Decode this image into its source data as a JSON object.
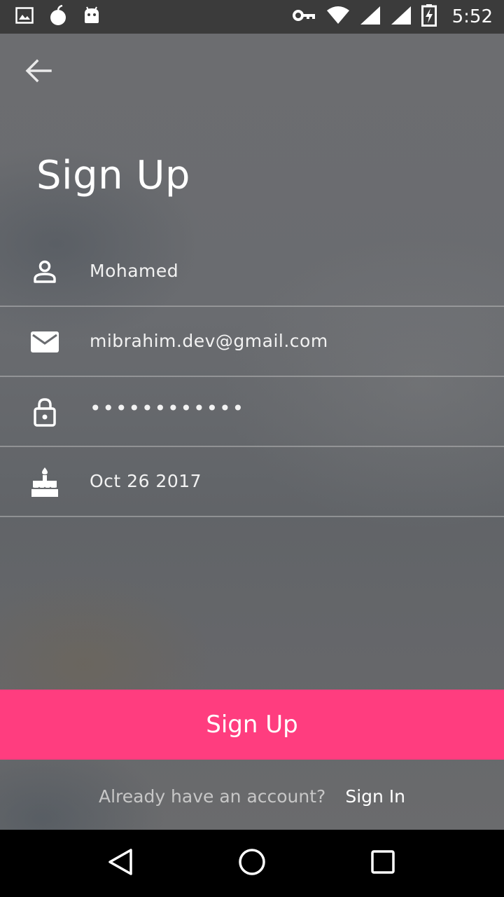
{
  "status_bar": {
    "time": "5:52",
    "icons_left": [
      "image-icon",
      "apple-notification-icon",
      "android-icon"
    ],
    "icons_right": [
      "vpn-key-icon",
      "wifi-icon",
      "signal-icon",
      "signal-icon",
      "battery-charging-icon"
    ]
  },
  "header": {
    "back_icon": "arrow-back-icon",
    "title": "Sign Up"
  },
  "form": {
    "name": {
      "icon": "person-icon",
      "value": "Mohamed"
    },
    "email": {
      "icon": "mail-icon",
      "value": "mibrahim.dev@gmail.com"
    },
    "password": {
      "icon": "lock-icon",
      "value": "••••••••••••"
    },
    "birthday": {
      "icon": "cake-icon",
      "value": "Oct 26 2017"
    }
  },
  "signup_button": {
    "label": "Sign Up"
  },
  "footer": {
    "question": "Already have an account?",
    "signin_label": "Sign In"
  },
  "nav_bar": {
    "icons": [
      "back-triangle-icon",
      "home-circle-icon",
      "recents-square-icon"
    ]
  },
  "colors": {
    "accent": "#ff3d7f",
    "status_bar": "#3b3b3b",
    "nav_bar": "#000000"
  }
}
